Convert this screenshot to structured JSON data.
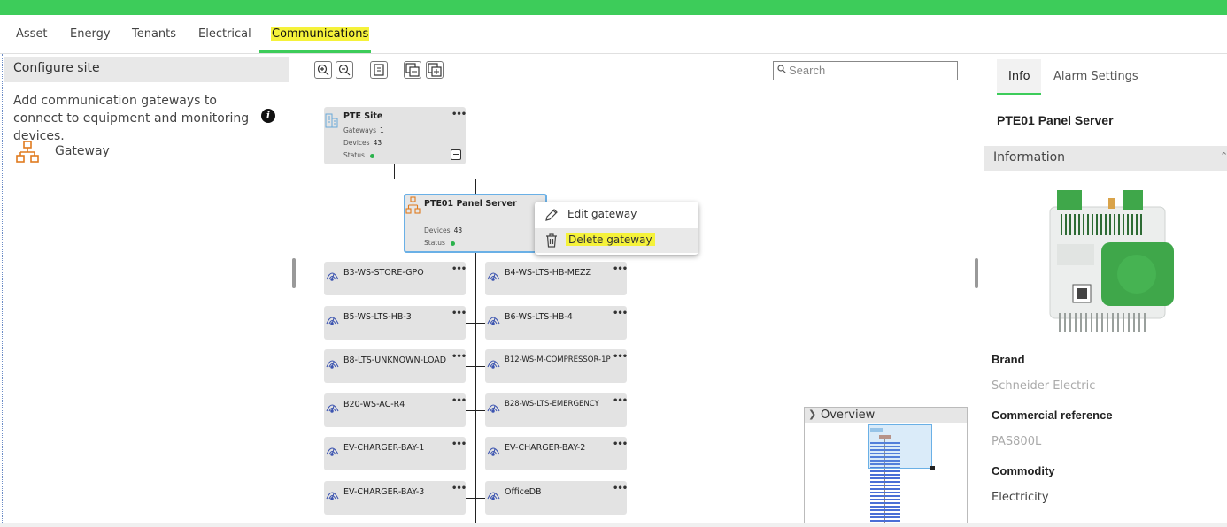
{
  "tabs": [
    "Asset",
    "Energy",
    "Tenants",
    "Electrical",
    "Communications"
  ],
  "left_panel": {
    "header": "Configure site",
    "description": "Add communication gateways to connect to equipment and monitoring devices.",
    "item_label": "Gateway"
  },
  "search": {
    "placeholder": "Search"
  },
  "site_node": {
    "name": "PTE Site",
    "gateways_label": "Gateways",
    "gateways_value": "1",
    "devices_label": "Devices",
    "devices_value": "43",
    "status_label": "Status"
  },
  "gateway_node": {
    "name": "PTE01 Panel Server",
    "devices_label": "Devices",
    "devices_value": "43",
    "status_label": "Status"
  },
  "context_menu": {
    "edit": "Edit gateway",
    "delete": "Delete gateway"
  },
  "devices_left": [
    "B3-WS-STORE-GPO",
    "B5-WS-LTS-HB-3",
    "B8-LTS-UNKNOWN-LOAD",
    "B20-WS-AC-R4",
    "EV-CHARGER-BAY-1",
    "EV-CHARGER-BAY-3"
  ],
  "devices_right": [
    "B4-WS-LTS-HB-MEZZ",
    "B6-WS-LTS-HB-4",
    "B12-WS-M-COMPRESSOR-1P",
    "B28-WS-LTS-EMERGENCY",
    "EV-CHARGER-BAY-2",
    "OfficeDB"
  ],
  "overview": {
    "title": "Overview"
  },
  "right_panel": {
    "tabs": [
      "Info",
      "Alarm Settings"
    ],
    "title": "PTE01 Panel Server",
    "section": "Information",
    "brand_label": "Brand",
    "brand_value": "Schneider Electric",
    "ref_label": "Commercial reference",
    "ref_value": "PAS800L",
    "commodity_label": "Commodity",
    "commodity_value": "Electricity"
  },
  "colors": {
    "accent": "#3dcc5a",
    "highlight": "#f5f23a",
    "status_ok": "#2bb24c",
    "gateway_icon": "#e07b1f"
  }
}
